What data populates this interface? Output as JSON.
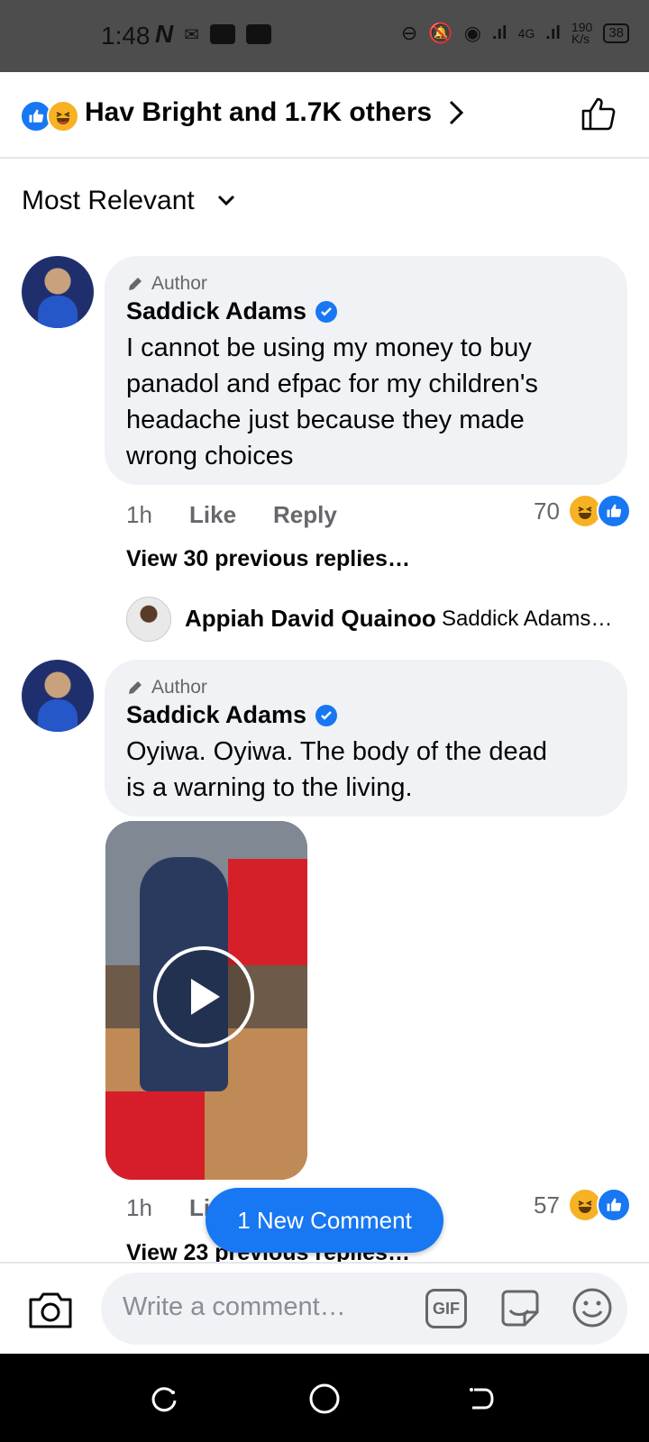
{
  "status_bar": {
    "time": "1:48",
    "network": "4G",
    "speed_value": "190",
    "speed_unit": "K/s",
    "battery": "38"
  },
  "reactions_header": {
    "reactors_text": "Hav Bright and 1.7K others"
  },
  "sort": {
    "label": "Most Relevant"
  },
  "comments": [
    {
      "author_tag": "Author",
      "name": "Saddick Adams",
      "text_lines": [
        "I cannot be using my money to buy",
        "panadol and efpac for my children's",
        "headache just because they made",
        "wrong choices"
      ],
      "time": "1h",
      "like": "Like",
      "reply": "Reply",
      "reaction_count": "70",
      "view_replies": "View 30 previous replies…",
      "latest_reply": {
        "name": "Appiah David Quainoo",
        "text": "Saddick Adams…"
      }
    },
    {
      "author_tag": "Author",
      "name": "Saddick Adams",
      "text_lines": [
        "Oyiwa. Oyiwa. The body of the dead",
        "is a warning to the living."
      ],
      "time": "1h",
      "like_partial": "Li",
      "reaction_count": "57",
      "view_replies": "View 23 previous replies…"
    }
  ],
  "new_comment_pill": "1 New Comment",
  "composer": {
    "placeholder": "Write a comment…",
    "gif_label": "GIF"
  },
  "colors": {
    "accent": "#1877f2",
    "bubble": "#f0f2f5",
    "meta_text": "#65676b",
    "haha": "#f7b125"
  }
}
